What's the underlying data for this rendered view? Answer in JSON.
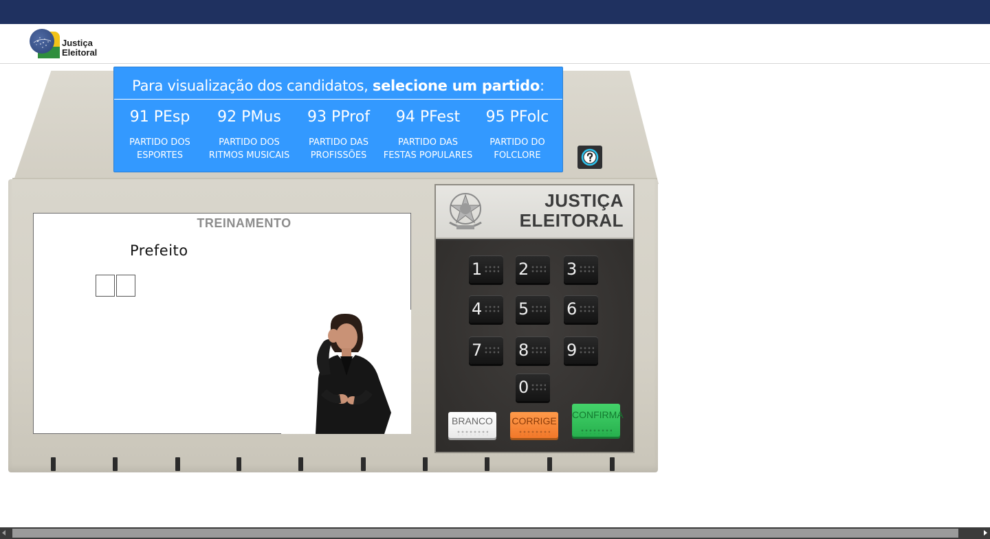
{
  "logo": {
    "line1": "Justiça",
    "line2": "Eleitoral"
  },
  "party_selector": {
    "heading_prefix": "Para visualização dos candidatos, ",
    "heading_bold": "selecione um partido",
    "heading_suffix": ":",
    "parties": [
      {
        "number_abbrev": "91 PEsp",
        "name_line1": "PARTIDO DOS",
        "name_line2": "ESPORTES"
      },
      {
        "number_abbrev": "92 PMus",
        "name_line1": "PARTIDO DOS",
        "name_line2": "RITMOS MUSICAIS"
      },
      {
        "number_abbrev": "93 PProf",
        "name_line1": "PARTIDO DAS",
        "name_line2": "PROFISSÕES"
      },
      {
        "number_abbrev": "94 PFest",
        "name_line1": "PARTIDO DAS",
        "name_line2": "FESTAS POPULARES"
      },
      {
        "number_abbrev": "95 PFolc",
        "name_line1": "PARTIDO DO",
        "name_line2": "FOLCLORE"
      }
    ]
  },
  "help": {
    "icon": "question-mark-icon"
  },
  "screen": {
    "mode_label": "TREINAMENTO",
    "office": "Prefeito",
    "digit_boxes": [
      "",
      ""
    ]
  },
  "panel": {
    "brand_line1": "JUSTIÇA",
    "brand_line2": "ELEITORAL",
    "keys": [
      "1",
      "2",
      "3",
      "4",
      "5",
      "6",
      "7",
      "8",
      "9",
      "0"
    ],
    "branco": "BRANCO",
    "corrige": "CORRIGE",
    "confirma": "CONFIRMA"
  },
  "colors": {
    "topbar": "#1f3160",
    "selector_blue": "#3399ff",
    "branco": "#ffffff",
    "corrige": "#f2782a",
    "confirma": "#27b14e"
  }
}
